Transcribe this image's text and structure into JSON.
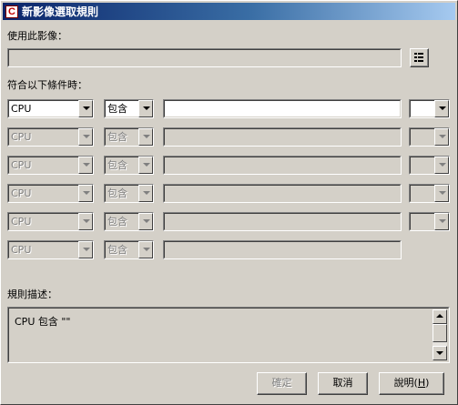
{
  "window": {
    "title": "新影像選取規則",
    "icon": "c-app-icon"
  },
  "use_image": {
    "label": "使用此影像：",
    "value": "",
    "browse_icon": "browse-list-icon"
  },
  "conditions": {
    "label": "符合以下條件時：",
    "rows": [
      {
        "field": "CPU",
        "operator": "包含",
        "value": "",
        "logic": "",
        "enabled": true
      },
      {
        "field": "CPU",
        "operator": "包含",
        "value": "",
        "logic": "",
        "enabled": false
      },
      {
        "field": "CPU",
        "operator": "包含",
        "value": "",
        "logic": "",
        "enabled": false
      },
      {
        "field": "CPU",
        "operator": "包含",
        "value": "",
        "logic": "",
        "enabled": false
      },
      {
        "field": "CPU",
        "operator": "包含",
        "value": "",
        "logic": "",
        "enabled": false
      },
      {
        "field": "CPU",
        "operator": "包含",
        "value": "",
        "logic": null,
        "enabled": false
      }
    ]
  },
  "description": {
    "label": "規則描述：",
    "text": "CPU 包含 \"\""
  },
  "buttons": {
    "ok": "確定",
    "cancel": "取消",
    "help_prefix": "說明(",
    "help_mnemonic": "H",
    "help_suffix": ")"
  },
  "colors": {
    "face": "#d4d0c8",
    "title_start": "#0a246a",
    "title_end": "#a6caf0",
    "disabled_text": "#808080"
  }
}
